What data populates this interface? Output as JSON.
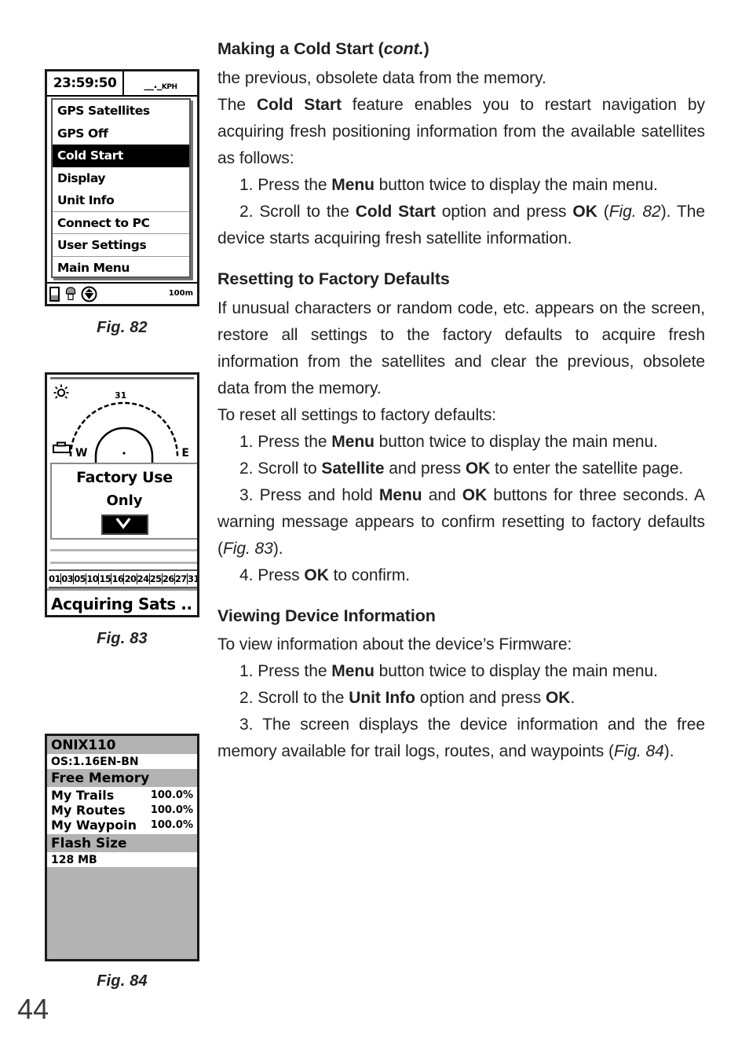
{
  "page": {
    "number": "44"
  },
  "figures": {
    "fig82": {
      "caption": "Fig. 82",
      "status": {
        "time": "23:59:50",
        "speed": "__._",
        "speed_unit": "KPH"
      },
      "menu_items": [
        {
          "label": "GPS Satellites",
          "selected": false,
          "rule": false
        },
        {
          "label": "GPS Off",
          "selected": false,
          "rule": false
        },
        {
          "label": "Cold Start",
          "selected": true,
          "rule": false
        },
        {
          "label": "Display",
          "selected": false,
          "rule": false
        },
        {
          "label": "Unit Info",
          "selected": false,
          "rule": true
        },
        {
          "label": "Connect to PC",
          "selected": false,
          "rule": true
        },
        {
          "label": "User Settings",
          "selected": false,
          "rule": true
        },
        {
          "label": "Main Menu",
          "selected": false,
          "rule": false
        }
      ],
      "bottom": {
        "scale": "100m"
      }
    },
    "fig83": {
      "caption": "Fig. 83",
      "sky": {
        "satellite_id": "31",
        "west": "W",
        "east": "E"
      },
      "dialog": {
        "line1": "Factory Use",
        "line2": "Only"
      },
      "satellite_ids": [
        "01",
        "03",
        "05",
        "10",
        "15",
        "16",
        "20",
        "24",
        "25",
        "26",
        "27",
        "31"
      ],
      "status": "Acquiring Sats .."
    },
    "fig84": {
      "caption": "Fig. 84",
      "model": "ONIX110",
      "os": "OS:1.16EN-BN",
      "free_memory_label": "Free Memory",
      "memory_rows": [
        {
          "name": "My Trails",
          "value": "100.0%"
        },
        {
          "name": "My Routes",
          "value": "100.0%"
        },
        {
          "name": "My Waypoin",
          "value": "100.0%"
        }
      ],
      "flash_label": "Flash Size",
      "flash_value": "128 MB"
    }
  },
  "sections": [
    {
      "title_plain": "Making a Cold Start (",
      "title_italic": "cont.",
      "title_tail": ")",
      "paragraphs": [
        "the previous, obsolete data from the memory.",
        "The Cold Start feature enables you to restart navigation by acquiring fresh positioning information from the available satellites as follows:"
      ],
      "steps": [
        "1. Press the Menu button twice to display the main menu.",
        "2. Scroll to the Cold Start option and press OK (Fig. 82). The device starts acquiring fresh satellite information."
      ]
    },
    {
      "title_plain": "Resetting to Factory Defaults",
      "paragraphs": [
        "If unusual characters or random code, etc. appears on the screen, restore all settings to the factory defaults to acquire fresh information from the satellites and clear the previous, obsolete data from the memory.",
        "To reset all settings to factory defaults:"
      ],
      "steps": [
        "1. Press the Menu button twice to display the main menu.",
        "2. Scroll to Satellite and press OK to enter the satellite page.",
        "3. Press and hold Menu and OK buttons for three seconds. A warning message appears to confirm resetting to factory defaults (Fig. 83).",
        "4. Press OK to confirm."
      ]
    },
    {
      "title_plain": "Viewing Device Information",
      "paragraphs": [
        "To view information about the device’s Firmware:"
      ],
      "steps": [
        "1. Press the Menu button twice to display the main menu.",
        "2. Scroll to the Unit Info option and press OK.",
        "3. The screen displays the device information and the free memory available for trail logs, routes, and waypoints (Fig. 84)."
      ]
    }
  ]
}
